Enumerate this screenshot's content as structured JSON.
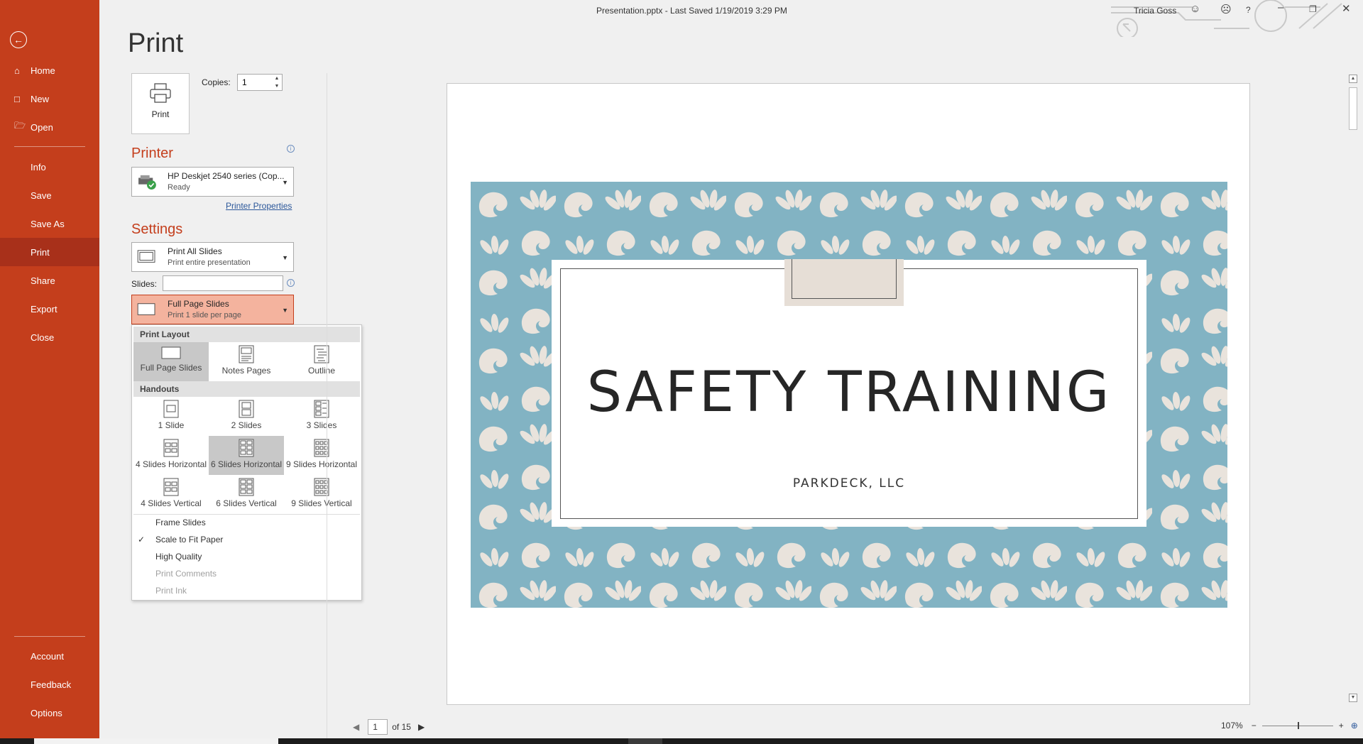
{
  "window": {
    "title": "Presentation.pptx  -  Last Saved 1/19/2019 3:29 PM",
    "user": "Tricia Goss"
  },
  "nav": {
    "items": [
      {
        "label": "Home"
      },
      {
        "label": "New"
      },
      {
        "label": "Open"
      },
      {
        "label": "Info"
      },
      {
        "label": "Save"
      },
      {
        "label": "Save As"
      },
      {
        "label": "Print"
      },
      {
        "label": "Share"
      },
      {
        "label": "Export"
      },
      {
        "label": "Close"
      }
    ],
    "bottom": [
      {
        "label": "Account"
      },
      {
        "label": "Feedback"
      },
      {
        "label": "Options"
      }
    ],
    "active": "Print"
  },
  "print": {
    "page_title": "Print",
    "print_button": "Print",
    "copies_label": "Copies:",
    "copies_value": "1",
    "printer_heading": "Printer",
    "printer_name": "HP Deskjet 2540 series (Cop...",
    "printer_status": "Ready",
    "printer_properties": "Printer Properties",
    "settings_heading": "Settings",
    "range_title": "Print All Slides",
    "range_sub": "Print entire presentation",
    "slides_label": "Slides:",
    "slides_value": "",
    "layout_title": "Full Page Slides",
    "layout_sub": "Print 1 slide per page"
  },
  "menu": {
    "print_layout_head": "Print Layout",
    "print_layout": [
      {
        "label": "Full Page Slides",
        "selected": true
      },
      {
        "label": "Notes Pages",
        "selected": false
      },
      {
        "label": "Outline",
        "selected": false
      }
    ],
    "handouts_head": "Handouts",
    "handouts_row1": [
      {
        "label": "1 Slide"
      },
      {
        "label": "2 Slides"
      },
      {
        "label": "3 Slides"
      }
    ],
    "handouts_row2": [
      {
        "label": "4 Slides Horizontal"
      },
      {
        "label": "6 Slides Horizontal",
        "selected": true
      },
      {
        "label": "9 Slides Horizontal"
      }
    ],
    "handouts_row3": [
      {
        "label": "4 Slides Vertical"
      },
      {
        "label": "6 Slides Vertical"
      },
      {
        "label": "9 Slides Vertical"
      }
    ],
    "options": [
      {
        "label": "Frame Slides",
        "checked": false,
        "enabled": true
      },
      {
        "label": "Scale to Fit Paper",
        "checked": true,
        "enabled": true
      },
      {
        "label": "High Quality",
        "checked": false,
        "enabled": true
      },
      {
        "label": "Print Comments",
        "checked": false,
        "enabled": false
      },
      {
        "label": "Print Ink",
        "checked": false,
        "enabled": false
      }
    ]
  },
  "preview": {
    "slide_title": "SAFETY TRAINING",
    "slide_subtitle": "PARKDECK, LLC",
    "current_page": "1",
    "of_pages": "of 15",
    "zoom": "107%"
  },
  "colors": {
    "accent": "#c43e1c",
    "slide_bg": "#82b3c3",
    "leaf": "#e9e3dc"
  }
}
